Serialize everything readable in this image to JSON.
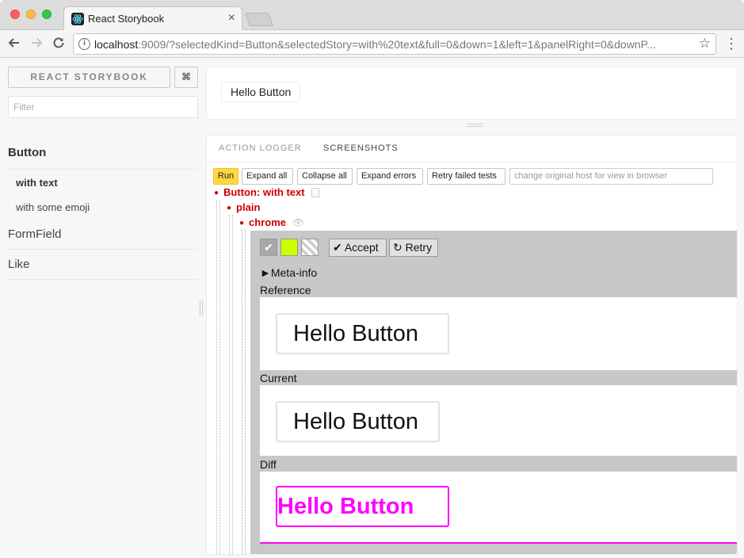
{
  "browser": {
    "tab_title": "React Storybook",
    "tab_close": "×",
    "url_host": "localhost",
    "url_rest": ":9009/?selectedKind=Button&selectedStory=with%20text&full=0&down=1&left=1&panelRight=0&downP..."
  },
  "sidebar": {
    "brand": "REACT STORYBOOK",
    "shortcut": "⌘",
    "filter_placeholder": "Filter",
    "kinds": [
      {
        "label": "Button",
        "stories": [
          "with text",
          "with some emoji"
        ]
      },
      {
        "label": "FormField"
      },
      {
        "label": "Like"
      }
    ]
  },
  "preview": {
    "button_label": "Hello Button"
  },
  "panel": {
    "tabs": [
      "ACTION LOGGER",
      "SCREENSHOTS"
    ],
    "buttons": {
      "run": "Run",
      "expand_all": "Expand all",
      "collapse_all": "Collapse all",
      "expand_errors": "Expand errors",
      "retry_failed": "Retry failed tests"
    },
    "host_placeholder": "change original host for view in browser",
    "tree": {
      "suite": "Button: with text",
      "state": "plain",
      "browser": "chrome"
    },
    "screenshot": {
      "accept": "✔ Accept",
      "retry": "↻ Retry",
      "meta": "►Meta-info",
      "reference_label": "Reference",
      "current_label": "Current",
      "diff_label": "Diff",
      "image_text": "Hello Button"
    }
  }
}
